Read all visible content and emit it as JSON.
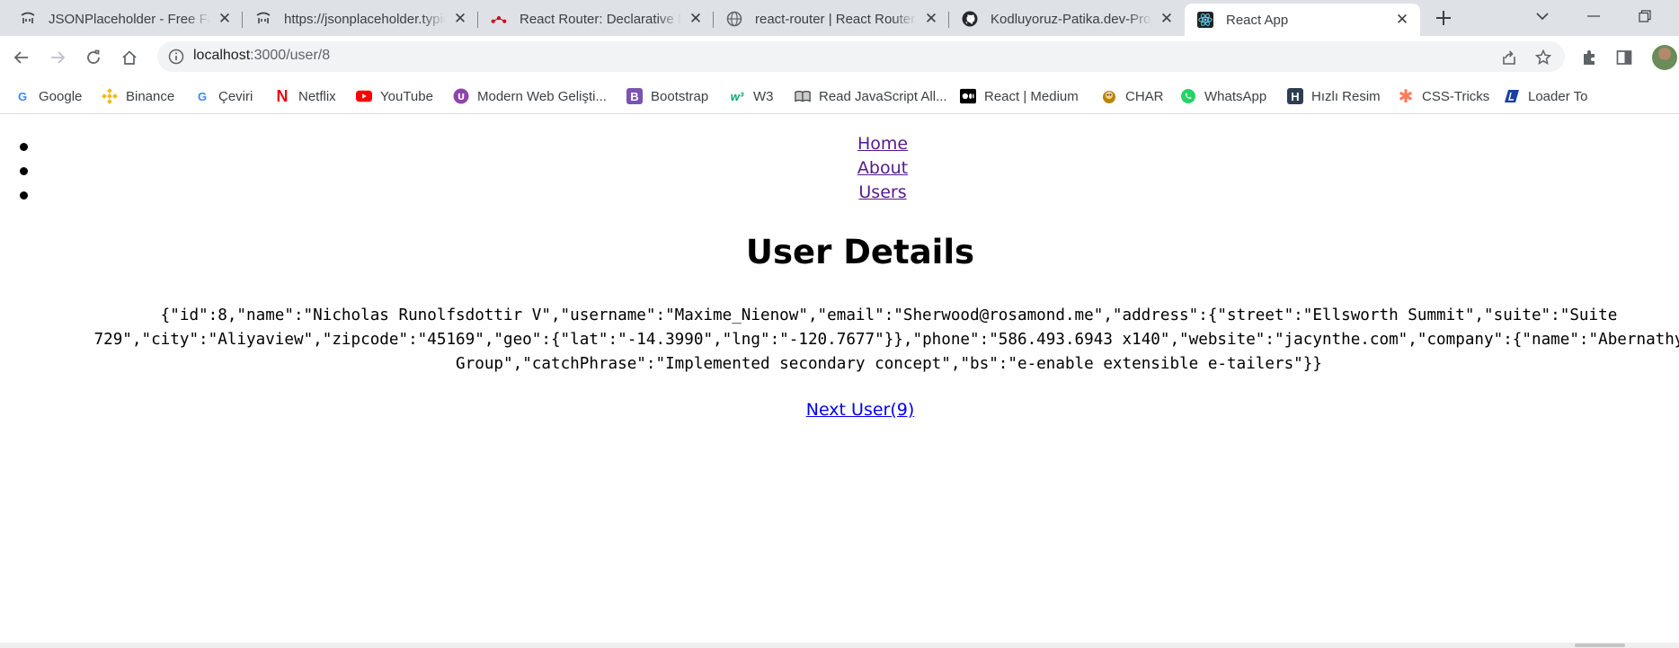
{
  "tabs": [
    {
      "title": "JSONPlaceholder - Free Fake REST API",
      "icon": "jsonplaceholder-icon"
    },
    {
      "title": "https://jsonplaceholder.typicode.com",
      "icon": "jsonplaceholder-icon"
    },
    {
      "title": "React Router: Declarative Routing",
      "icon": "react-router-icon"
    },
    {
      "title": "react-router | React Router",
      "icon": "globe-icon"
    },
    {
      "title": "Kodluyoruz-Patika.dev-Projects",
      "icon": "github-icon"
    },
    {
      "title": "React App",
      "icon": "react-icon",
      "active": true
    }
  ],
  "toolbar": {
    "url_host": "localhost",
    "url_path": ":3000/user/8"
  },
  "bookmarks": [
    {
      "label": "Google",
      "icon": "google-icon",
      "color": "#4285f4"
    },
    {
      "label": "Binance",
      "icon": "binance-icon",
      "color": "#f0b90b"
    },
    {
      "label": "Çeviri",
      "icon": "google-icon",
      "color": "#4285f4"
    },
    {
      "label": "Netflix",
      "icon": "netflix-icon",
      "color": "#e50914"
    },
    {
      "label": "YouTube",
      "icon": "youtube-icon",
      "color": "#ff0000"
    },
    {
      "label": "Modern Web Gelişti...",
      "icon": "modern-web-icon",
      "color": "#8e44ad"
    },
    {
      "label": "Bootstrap",
      "icon": "bootstrap-icon",
      "color": "#7952b3"
    },
    {
      "label": "W3",
      "icon": "w3-icon",
      "color": "#04aa6d"
    },
    {
      "label": "Read JavaScript All...",
      "icon": "book-icon",
      "color": "#3c4043"
    },
    {
      "label": "React | Medium",
      "icon": "medium-icon",
      "color": "#000000"
    },
    {
      "label": "CHAR",
      "icon": "char-icon",
      "color": "#b8860b"
    },
    {
      "label": "WhatsApp",
      "icon": "whatsapp-icon",
      "color": "#25d366"
    },
    {
      "label": "Hızlı Resim",
      "icon": "hizli-resim-icon",
      "color": "#2c3e50"
    },
    {
      "label": "CSS-Tricks",
      "icon": "css-tricks-icon",
      "color": "#ff7a59"
    },
    {
      "label": "Loader To",
      "icon": "loader-to-icon",
      "color": "#1a3fa3"
    }
  ],
  "page": {
    "nav": [
      {
        "label": "Home"
      },
      {
        "label": "About"
      },
      {
        "label": "Users"
      }
    ],
    "heading": "User Details",
    "user_json": "{\"id\":8,\"name\":\"Nicholas Runolfsdottir V\",\"username\":\"Maxime_Nienow\",\"email\":\"Sherwood@rosamond.me\",\"address\":{\"street\":\"Ellsworth Summit\",\"suite\":\"Suite 729\",\"city\":\"Aliyaview\",\"zipcode\":\"45169\",\"geo\":{\"lat\":\"-14.3990\",\"lng\":\"-120.7677\"}},\"phone\":\"586.493.6943 x140\",\"website\":\"jacynthe.com\",\"company\":{\"name\":\"Abernathy Group\",\"catchPhrase\":\"Implemented secondary concept\",\"bs\":\"e-enable extensible e-tailers\"}}",
    "next_link": "Next User(9)"
  },
  "colors": {
    "tabstrip_bg": "#dee1e6",
    "visited_link": "#551a8b",
    "link": "#0000ee"
  }
}
